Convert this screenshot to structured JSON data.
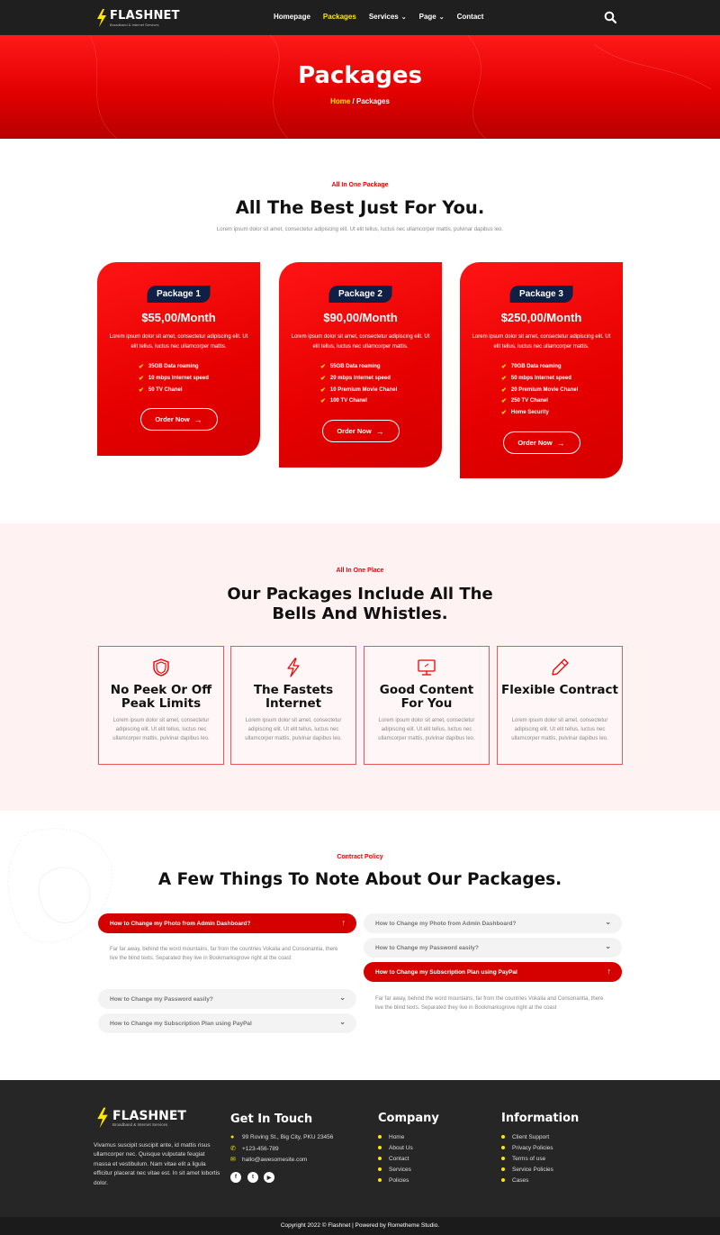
{
  "brand": {
    "name": "FLASHNET",
    "tagline": "Broadband & Internet Services"
  },
  "nav": {
    "items": [
      {
        "label": "Homepage"
      },
      {
        "label": "Packages",
        "active": true
      },
      {
        "label": "Services",
        "dropdown": true
      },
      {
        "label": "Page",
        "dropdown": true
      },
      {
        "label": "Contact"
      }
    ],
    "search_icon": "search-icon"
  },
  "hero": {
    "title": "Packages",
    "crumb_home": "Home",
    "crumb_sep": " / ",
    "crumb_current": "Packages"
  },
  "packages": {
    "kicker": "All In One Package",
    "title": "All The Best Just For You.",
    "subtitle": "Lorem ipsum dolor sit amet, consectetur adipiscing elit. Ut elit tellus, luctus nec ullamcorper mattis, pulvinar dapibus leo.",
    "cards": [
      {
        "name": "Package 1",
        "price": "$55,00/Month",
        "desc": "Lorem ipsum dolor sit amet, consectetur adipiscing elit. Ut elit tellus, luctus nec ullamcorper mattis.",
        "features": [
          "35GB Data roaming",
          "10 mbps Internet speed",
          "50 TV Chanel"
        ],
        "cta": "Order Now"
      },
      {
        "name": "Package 2",
        "price": "$90,00/Month",
        "desc": "Lorem ipsum dolor sit amet, consectetur adipiscing elit. Ut elit tellus, luctus nec ullamcorper mattis.",
        "features": [
          "55GB Data roaming",
          "20 mbps Internet speed",
          "10 Premium Movie Chanel",
          "100 TV Chanel"
        ],
        "cta": "Order Now"
      },
      {
        "name": "Package 3",
        "price": "$250,00/Month",
        "desc": "Lorem ipsum dolor sit amet, consectetur adipiscing elit. Ut elit tellus, luctus nec ullamcorper mattis.",
        "features": [
          "70GB Data roaming",
          "50 mbps Internet speed",
          "20 Premium Movie Chanel",
          "250 TV Chanel",
          "Home Security"
        ],
        "cta": "Order Now"
      }
    ]
  },
  "features": {
    "kicker": "All In One Place",
    "title_line1": "Our Packages Include All The",
    "title_line2": "Bells And Whistles.",
    "items": [
      {
        "icon": "shield-icon",
        "title": "No Peek Or Off Peak Limits",
        "text": "Lorem ipsum dolor sit amet, consectetur adipiscing elit. Ut elit tellus, luctus nec ullamcorper mattis, pulvinar dapibus leo."
      },
      {
        "icon": "lightning-icon",
        "title": "The Fastets Internet",
        "text": "Lorem ipsum dolor sit amet, consectetur adipiscing elit. Ut elit tellus, luctus nec ullamcorper mattis, pulvinar dapibus leo."
      },
      {
        "icon": "monitor-icon",
        "title": "Good Content For You",
        "text": "Lorem ipsum dolor sit amet, consectetur adipiscing elit. Ut elit tellus, luctus nec ullamcorper mattis, pulvinar dapibus leo."
      },
      {
        "icon": "pen-icon",
        "title": "Flexible Contract",
        "text": "Lorem ipsum dolor sit amet, consectetur adipiscing elit. Ut elit tellus, luctus nec ullamcorper mattis, pulvinar dapibus leo."
      }
    ]
  },
  "faq": {
    "kicker": "Contract Policy",
    "title": "A Few Things To Note About Our Packages.",
    "answer": "Far far away, behind the word mountains, far from the countries Vokalia and Consonantia, there live the blind texts. Separated they live in Bookmarksgrove right at the coast",
    "left": [
      {
        "q": "How to Change my Photo from Admin Dashboard?",
        "open": true
      },
      {
        "q": "How to Change my Password easily?",
        "open": false
      },
      {
        "q": "How to Change my Subscription Plan using PayPal",
        "open": false
      }
    ],
    "right": [
      {
        "q": "How to Change my Photo from Admin Dashboard?",
        "open": false
      },
      {
        "q": "How to Change my Password easily?",
        "open": false
      },
      {
        "q": "How to Change my Subscription Plan using PayPal",
        "open": true
      }
    ]
  },
  "footer": {
    "about": "Vivamus suscipit suscipit ante, id mattis risus ullamcorper nec. Quisque vulputate feugiat massa et vestibulum. Nam vitae elit a ligula efficitur placerat nec vitae est. In sit amet lobortis dolor.",
    "contact_title": "Get In Touch",
    "address": "99 Roving St., Big City, PKU 23456",
    "phone": "+123-456-789",
    "email": "hallo@awesomesite.com",
    "social": [
      "facebook-icon",
      "twitter-icon",
      "youtube-icon"
    ],
    "company_title": "Company",
    "company": [
      "Home",
      "About Us",
      "Contact",
      "Services",
      "Policies"
    ],
    "info_title": "Information",
    "info": [
      "Client Support",
      "Privacy Policies",
      "Terms of use",
      "Service Policies",
      "Cases"
    ],
    "copyright": "Copyright 2022 © Flashnet | Powered by Rometheme Studio."
  },
  "colors": {
    "accent": "#e00000",
    "navy": "#0f1f45",
    "yellow": "#ffe600",
    "dark": "#262626"
  }
}
